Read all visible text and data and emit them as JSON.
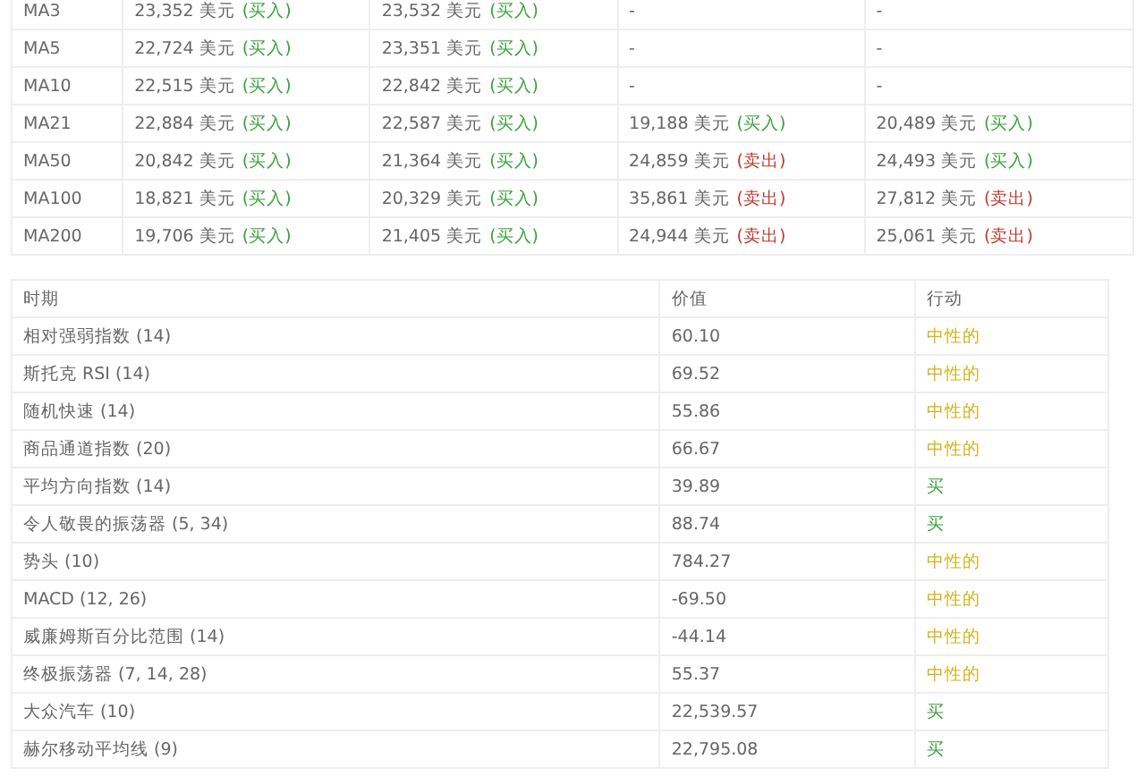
{
  "ma_table": {
    "rows": [
      {
        "period": "MA3",
        "cells": [
          {
            "value": "23,352 美元",
            "signal": "(买入)",
            "kind": "buy"
          },
          {
            "value": "23,532 美元",
            "signal": "(买入)",
            "kind": "buy"
          },
          {
            "value": "-"
          },
          {
            "value": "-"
          }
        ]
      },
      {
        "period": "MA5",
        "cells": [
          {
            "value": "22,724 美元",
            "signal": "(买入)",
            "kind": "buy"
          },
          {
            "value": "23,351 美元",
            "signal": "(买入)",
            "kind": "buy"
          },
          {
            "value": "-"
          },
          {
            "value": "-"
          }
        ]
      },
      {
        "period": "MA10",
        "cells": [
          {
            "value": "22,515 美元",
            "signal": "(买入)",
            "kind": "buy"
          },
          {
            "value": "22,842 美元",
            "signal": "(买入)",
            "kind": "buy"
          },
          {
            "value": "-"
          },
          {
            "value": "-"
          }
        ]
      },
      {
        "period": "MA21",
        "cells": [
          {
            "value": "22,884 美元",
            "signal": "(买入)",
            "kind": "buy"
          },
          {
            "value": "22,587 美元",
            "signal": "(买入)",
            "kind": "buy"
          },
          {
            "value": "19,188 美元",
            "signal": "(买入)",
            "kind": "buy"
          },
          {
            "value": "20,489 美元",
            "signal": "(买入)",
            "kind": "buy"
          }
        ]
      },
      {
        "period": "MA50",
        "cells": [
          {
            "value": "20,842 美元",
            "signal": "(买入)",
            "kind": "buy"
          },
          {
            "value": "21,364 美元",
            "signal": "(买入)",
            "kind": "buy"
          },
          {
            "value": "24,859 美元",
            "signal": "(卖出)",
            "kind": "sell"
          },
          {
            "value": "24,493 美元",
            "signal": "(买入)",
            "kind": "buy"
          }
        ]
      },
      {
        "period": "MA100",
        "cells": [
          {
            "value": "18,821 美元",
            "signal": "(买入)",
            "kind": "buy"
          },
          {
            "value": "20,329 美元",
            "signal": "(买入)",
            "kind": "buy"
          },
          {
            "value": "35,861 美元",
            "signal": "(卖出)",
            "kind": "sell"
          },
          {
            "value": "27,812 美元",
            "signal": "(卖出)",
            "kind": "sell"
          }
        ]
      },
      {
        "period": "MA200",
        "cells": [
          {
            "value": "19,706 美元",
            "signal": "(买入)",
            "kind": "buy"
          },
          {
            "value": "21,405 美元",
            "signal": "(买入)",
            "kind": "buy"
          },
          {
            "value": "24,944 美元",
            "signal": "(卖出)",
            "kind": "sell"
          },
          {
            "value": "25,061 美元",
            "signal": "(卖出)",
            "kind": "sell"
          }
        ]
      }
    ]
  },
  "oscillator_table": {
    "columns": [
      "时期",
      "价值",
      "行动"
    ],
    "rows": [
      {
        "name": "相对强弱指数 (14)",
        "value": "60.10",
        "action": "中性的",
        "kind": "neutral"
      },
      {
        "name": "斯托克 RSI (14)",
        "value": "69.52",
        "action": "中性的",
        "kind": "neutral"
      },
      {
        "name": "随机快速 (14)",
        "value": "55.86",
        "action": "中性的",
        "kind": "neutral"
      },
      {
        "name": "商品通道指数 (20)",
        "value": "66.67",
        "action": "中性的",
        "kind": "neutral"
      },
      {
        "name": "平均方向指数 (14)",
        "value": "39.89",
        "action": "买",
        "kind": "buy"
      },
      {
        "name": "令人敬畏的振荡器 (5, 34)",
        "value": "88.74",
        "action": "买",
        "kind": "buy"
      },
      {
        "name": "势头 (10)",
        "value": "784.27",
        "action": "中性的",
        "kind": "neutral"
      },
      {
        "name": "MACD (12, 26)",
        "value": "-69.50",
        "action": "中性的",
        "kind": "neutral"
      },
      {
        "name": "威廉姆斯百分比范围 (14)",
        "value": "-44.14",
        "action": "中性的",
        "kind": "neutral"
      },
      {
        "name": "终极振荡器 (7, 14, 28)",
        "value": "55.37",
        "action": "中性的",
        "kind": "neutral"
      },
      {
        "name": "大众汽车 (10)",
        "value": "22,539.57",
        "action": "买",
        "kind": "buy"
      },
      {
        "name": "赫尔移动平均线 (9)",
        "value": "22,795.08",
        "action": "买",
        "kind": "buy"
      }
    ]
  }
}
